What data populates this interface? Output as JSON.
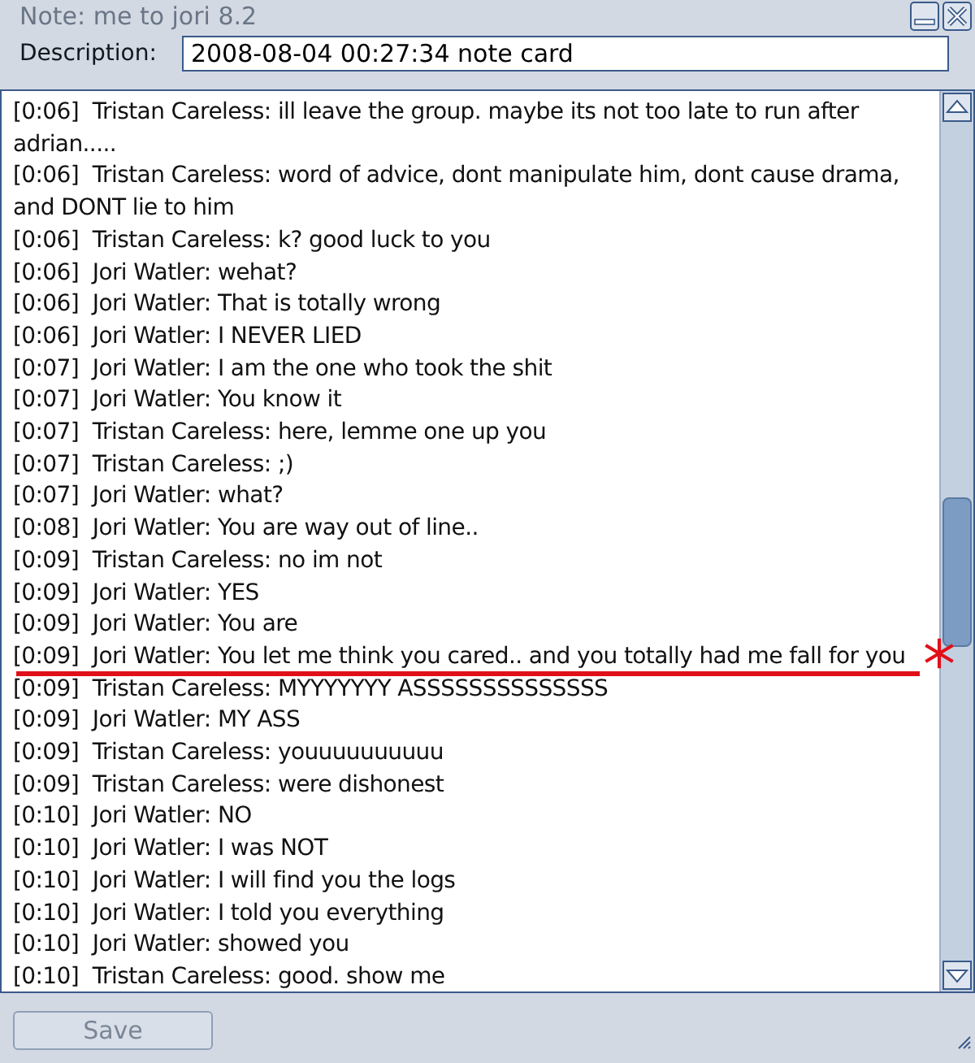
{
  "window": {
    "title": "Note: me to jori 8.2",
    "active": false
  },
  "description": {
    "label": "Description:",
    "value": "2008-08-04 00:27:34 note card"
  },
  "lines": [
    {
      "text": "[0:06]  Tristan Careless: ill leave the group. maybe its not too late to run after adrian.....",
      "underlined": false
    },
    {
      "text": "[0:06]  Tristan Careless: word of advice, dont manipulate him, dont cause drama, and DONT lie to him",
      "underlined": false
    },
    {
      "text": "[0:06]  Tristan Careless: k? good luck to you",
      "underlined": false
    },
    {
      "text": "[0:06]  Jori Watler: wehat?",
      "underlined": false
    },
    {
      "text": "[0:06]  Jori Watler: That is totally wrong",
      "underlined": false
    },
    {
      "text": "[0:06]  Jori Watler: I NEVER LIED",
      "underlined": false
    },
    {
      "text": "[0:07]  Jori Watler: I am the one who took the shit",
      "underlined": false
    },
    {
      "text": "[0:07]  Jori Watler: You know it",
      "underlined": false
    },
    {
      "text": "[0:07]  Tristan Careless: here, lemme one up you",
      "underlined": false
    },
    {
      "text": "[0:07]  Tristan Careless: ;)",
      "underlined": false
    },
    {
      "text": "[0:07]  Jori Watler: what?",
      "underlined": false
    },
    {
      "text": "[0:08]  Jori Watler: You are way out of line..",
      "underlined": false
    },
    {
      "text": "[0:09]  Tristan Careless: no im not",
      "underlined": false
    },
    {
      "text": "[0:09]  Jori Watler: YES",
      "underlined": false
    },
    {
      "text": "[0:09]  Jori Watler: You are",
      "underlined": false
    },
    {
      "text": "[0:09]  Jori Watler: You let me think you cared.. and you totally had me fall for you",
      "underlined": true
    },
    {
      "text": "[0:09]  Tristan Careless: MYYYYYYY ASSSSSSSSSSSSSS",
      "underlined": false
    },
    {
      "text": "[0:09]  Jori Watler: MY ASS",
      "underlined": false
    },
    {
      "text": "[0:09]  Tristan Careless: youuuuuuuuuu",
      "underlined": false
    },
    {
      "text": "[0:09]  Tristan Careless: were dishonest",
      "underlined": false
    },
    {
      "text": "[0:10]  Jori Watler: NO",
      "underlined": false
    },
    {
      "text": "[0:10]  Jori Watler: I was NOT",
      "underlined": false
    },
    {
      "text": "[0:10]  Jori Watler: I will find you the logs",
      "underlined": false
    },
    {
      "text": "[0:10]  Jori Watler: I told you everything",
      "underlined": false
    },
    {
      "text": "[0:10]  Jori Watler: showed you",
      "underlined": false
    },
    {
      "text": "[0:10]  Tristan Careless: good. show me",
      "underlined": false
    }
  ],
  "save_button": {
    "label": "Save",
    "disabled": true
  }
}
